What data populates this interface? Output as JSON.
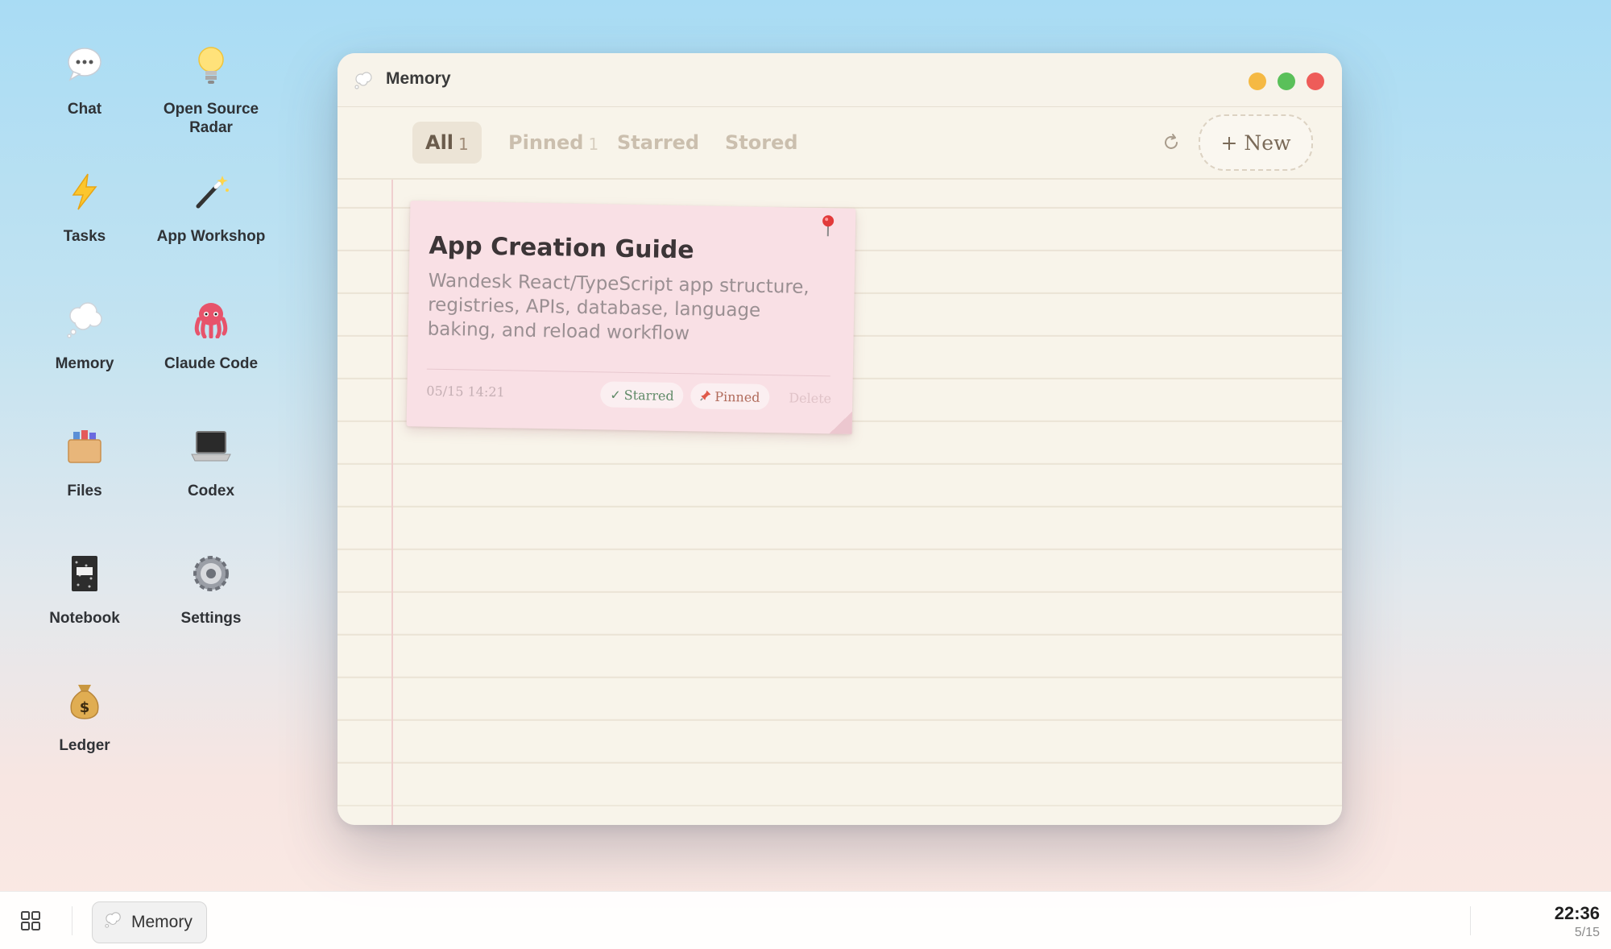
{
  "desktop": {
    "icons": [
      {
        "label": "Chat",
        "icon": "chat-bubble-icon"
      },
      {
        "label": "Open Source Radar",
        "icon": "lightbulb-icon"
      },
      {
        "label": "Tasks",
        "icon": "lightning-icon"
      },
      {
        "label": "App Workshop",
        "icon": "magic-wand-icon"
      },
      {
        "label": "Memory",
        "icon": "thought-bubble-icon"
      },
      {
        "label": "Claude Code",
        "icon": "octopus-icon"
      },
      {
        "label": "Files",
        "icon": "file-box-icon"
      },
      {
        "label": "Codex",
        "icon": "laptop-icon"
      },
      {
        "label": "Notebook",
        "icon": "notebook-icon"
      },
      {
        "label": "Settings",
        "icon": "gear-icon"
      },
      {
        "label": "Ledger",
        "icon": "money-bag-icon"
      }
    ]
  },
  "window": {
    "title": "Memory",
    "tabs": [
      {
        "label": "All",
        "count": "1",
        "active": true
      },
      {
        "label": "Pinned",
        "count": "1",
        "active": false
      },
      {
        "label": "Starred",
        "count": "",
        "active": false
      },
      {
        "label": "Stored",
        "count": "",
        "active": false
      }
    ],
    "new_button": "+ New",
    "note": {
      "title": "App Creation Guide",
      "body": "Wandesk React/TypeScript app structure, registries, APIs, database, language baking, and reload workflow",
      "date": "05/15 14:21",
      "starred_label": "Starred",
      "pinned_label": "Pinned",
      "delete_label": "Delete"
    }
  },
  "taskbar": {
    "active_app": "Memory",
    "time": "22:36",
    "date": "5/15"
  },
  "colors": {
    "note_background": "#f9e0e5",
    "paper": "#f8f4ea",
    "traffic_min": "#f5b944",
    "traffic_max": "#5ac05a",
    "traffic_close": "#ee5c59"
  }
}
